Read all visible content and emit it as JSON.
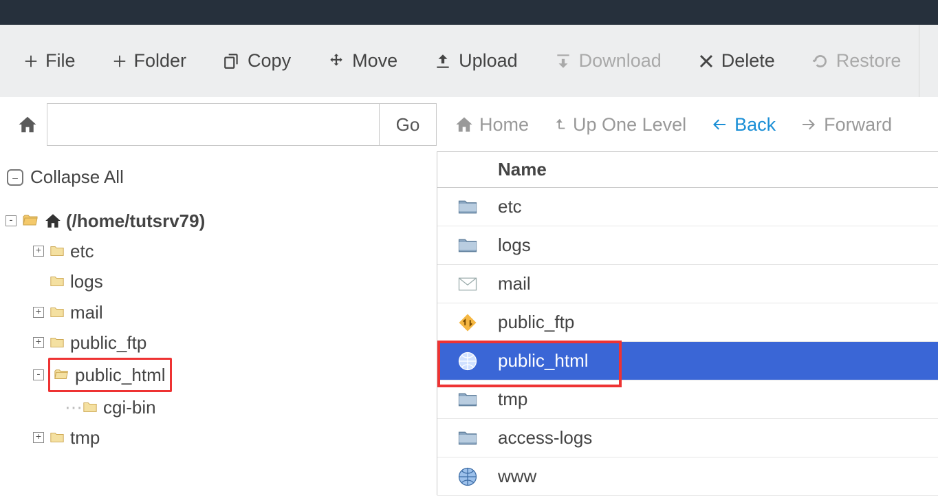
{
  "toolbar": {
    "file": {
      "label": "File"
    },
    "folder": {
      "label": "Folder"
    },
    "copy": {
      "label": "Copy"
    },
    "move": {
      "label": "Move"
    },
    "upload": {
      "label": "Upload"
    },
    "download": {
      "label": "Download"
    },
    "delete": {
      "label": "Delete"
    },
    "restore": {
      "label": "Restore"
    }
  },
  "pathbar": {
    "value": "",
    "go_label": "Go"
  },
  "nav": {
    "home": "Home",
    "up": "Up One Level",
    "back": "Back",
    "forward": "Forward"
  },
  "sidebar": {
    "collapse_all": "Collapse All",
    "root_label": "(/home/tutsrv79)",
    "tree": [
      {
        "label": "etc",
        "expandable": true,
        "expanded": false
      },
      {
        "label": "logs",
        "expandable": false,
        "expanded": false
      },
      {
        "label": "mail",
        "expandable": true,
        "expanded": false
      },
      {
        "label": "public_ftp",
        "expandable": true,
        "expanded": false
      },
      {
        "label": "public_html",
        "expandable": true,
        "expanded": true,
        "highlighted": true,
        "children": [
          {
            "label": "cgi-bin"
          }
        ]
      },
      {
        "label": "tmp",
        "expandable": true,
        "expanded": false
      }
    ]
  },
  "list": {
    "header": {
      "name": "Name"
    },
    "rows": [
      {
        "icon": "folder",
        "name": "etc"
      },
      {
        "icon": "folder",
        "name": "logs"
      },
      {
        "icon": "mail",
        "name": "mail"
      },
      {
        "icon": "ftp",
        "name": "public_ftp"
      },
      {
        "icon": "globe",
        "name": "public_html",
        "selected": true,
        "highlighted": true
      },
      {
        "icon": "folder",
        "name": "tmp"
      },
      {
        "icon": "folder",
        "name": "access-logs"
      },
      {
        "icon": "globe",
        "name": "www"
      }
    ]
  },
  "colors": {
    "selection": "#3a66d6",
    "highlight_border": "#e33",
    "link": "#1b8fd6"
  }
}
